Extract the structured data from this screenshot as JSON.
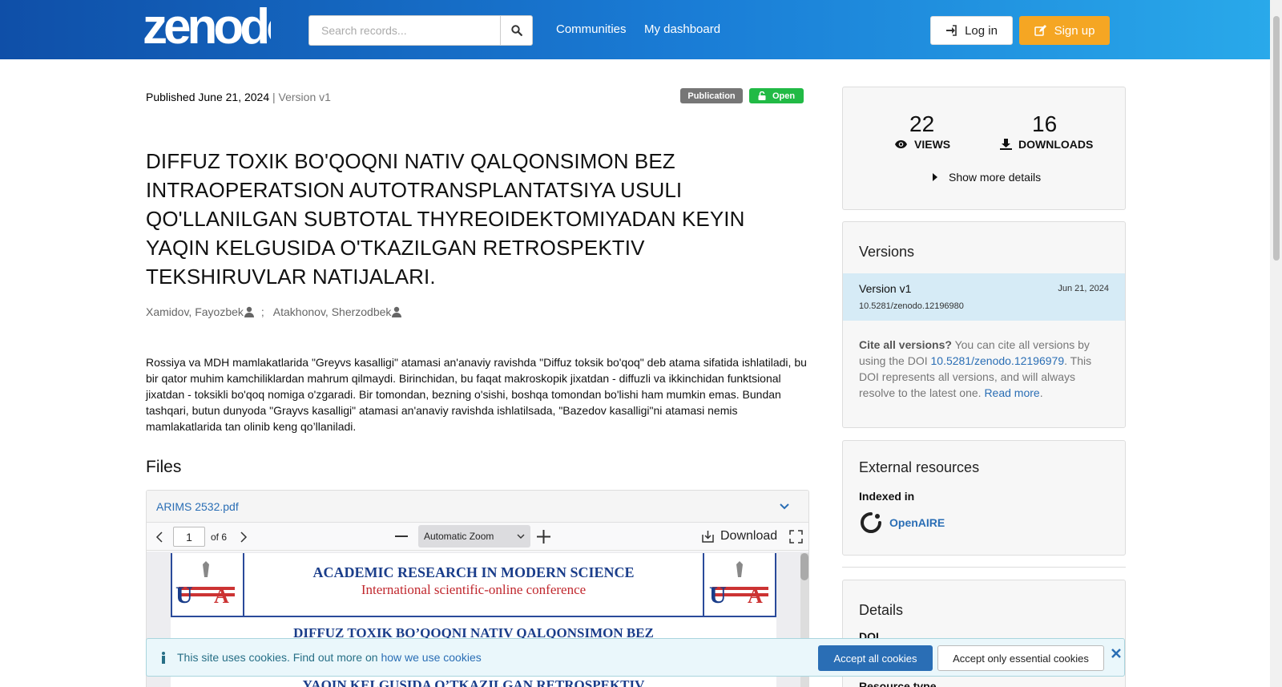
{
  "header": {
    "logo_text": "zenodo",
    "search_placeholder": "Search records...",
    "nav": [
      "Communities",
      "My dashboard"
    ],
    "login_label": "Log in",
    "signup_label": "Sign up"
  },
  "record": {
    "published_label": "Published June 21, 2024",
    "version_label": "| Version v1",
    "badge_type": "Publication",
    "badge_access": "Open",
    "title": "DIFFUZ TOXIK BO'QOQNI NATIV QALQONSIMON BEZ INTRAOPERATSION AUTOTRANSPLANTATSIYA USULI QO'LLANILGAN SUBTOTAL THYREOIDEKTOMIYADAN KEYIN YAQIN KELGUSIDA O'TKAZILGAN RETROSPEKTIV TEKSHIRUVLAR NATIJALARI.",
    "authors": [
      "Xamidov, Fayozbek",
      "Atakhonov, Sherzodbek"
    ],
    "author_separator": ";",
    "abstract": "Rossiya va MDH mamlakatlarida \"Greyvs kasalligi\" atamasi an'anaviy ravishda \"Diffuz toksik bo'qoq\" deb atama sifatida ishlatiladi, bu bir qator muhim kamchiliklardan mahrum qilmaydi. Birinchidan, bu faqat makroskopik jixatdan - diffuzli va ikkinchidan funktsional jixatdan - toksikli bo'qoq nomiga o'zgaradi. Bir tomondan, bezning o'sishi, boshqa tomondan bo'lishi ham mumkin emas. Bundan tashqari, butun dunyoda \"Grayvs kasalligi\" atamasi an'anaviy ravishda ishlatilsada, \"Bazedov kasalligi\"ni atamasi nemis mamlakatlarida tan olinib keng qo’llaniladi."
  },
  "files": {
    "heading": "Files",
    "file_name": "ARIMS 2532.pdf",
    "viewer": {
      "page_value": "1",
      "page_total": "of 6",
      "zoom": "Automatic Zoom",
      "download_label": "Download",
      "doc_header_line1": "ACADEMIC RESEARCH IN MODERN SCIENCE",
      "doc_header_line2": "International scientific-online conference",
      "doc_title_line1": "DIFFUZ TOXIK BO’QOQNI NATIV QALQONSIMON BEZ",
      "doc_title_line3": "YAQIN KELGUSIDA O’TKAZILGAN RETROSPEKTIV"
    }
  },
  "stats": {
    "views": "22",
    "views_label": "VIEWS",
    "downloads": "16",
    "downloads_label": "DOWNLOADS",
    "more_label": "Show more details"
  },
  "versions": {
    "heading": "Versions",
    "item_label": "Version v1",
    "item_date": "Jun 21, 2024",
    "item_doi": "10.5281/zenodo.12196980",
    "cite_bold": "Cite all versions?",
    "cite_text1": " You can cite all versions by using the DOI ",
    "cite_doi": "10.5281/zenodo.12196979",
    "cite_text2": ". This DOI represents all versions, and will always resolve to the latest one. ",
    "read_more": "Read more",
    "cite_end": "."
  },
  "external": {
    "heading": "External resources",
    "indexed_label": "Indexed in",
    "openaire": "OpenAIRE"
  },
  "details": {
    "heading": "Details",
    "doi_label": "DOI",
    "resource_type_label": "Resource type"
  },
  "cookie": {
    "text": "This site uses cookies. Find out more on ",
    "link": "how we use cookies",
    "accept_all": "Accept all cookies",
    "accept_essential": "Accept only essential cookies"
  },
  "colors": {
    "header_start": "#0f4fa8",
    "header_end": "#29a9ea",
    "signup": "#f5a623",
    "open_badge": "#21ba45",
    "link": "#2a6eb5"
  }
}
